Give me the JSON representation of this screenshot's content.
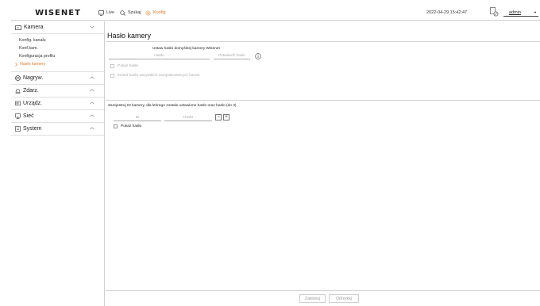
{
  "header": {
    "logo": "WISENET",
    "nav": [
      {
        "label": "Live",
        "icon": "monitor-icon"
      },
      {
        "label": "Szukaj",
        "icon": "search-icon"
      },
      {
        "label": "Konfig",
        "icon": "gear-icon",
        "active": true
      }
    ],
    "datetime": "2022-04-29 15:42:47",
    "user": "admin",
    "accent_color": "#e07b2a"
  },
  "sidebar": {
    "categories": [
      {
        "label": "Kamera",
        "icon": "camera-icon",
        "expanded": true,
        "items": [
          {
            "label": "Konfig. kanału"
          },
          {
            "label": "Konf.kam."
          },
          {
            "label": "Konfiguracja profilu"
          },
          {
            "label": "Hasło kamery",
            "active": true
          }
        ]
      },
      {
        "label": "Nagryw.",
        "icon": "record-icon"
      },
      {
        "label": "Zdarz.",
        "icon": "bell-icon"
      },
      {
        "label": "Urządz.",
        "icon": "device-icon"
      },
      {
        "label": "Sieć",
        "icon": "network-icon"
      },
      {
        "label": "System",
        "icon": "system-icon"
      }
    ]
  },
  "main": {
    "title": "Hasło kamery",
    "section1": {
      "title": "Ustaw hasło domyślnej kamery Wisenet",
      "password_placeholder": "Hasło",
      "confirm_placeholder": "Potwierdź hasło",
      "show_password": "Pokaż hasło",
      "change_all": "Zmień hasło wszystkich zarejestrowanych kamer."
    },
    "section2": {
      "title": "Zarejestruj ID kamery, dla którego zostało ustawione hasło oraz hasło (do 3)",
      "id_placeholder": "ID",
      "password_placeholder": "Hasło",
      "minus": "−",
      "plus": "+",
      "show_password": "Pokaż hasło"
    },
    "footer": {
      "apply": "Zastosuj",
      "cancel": "Odrzykaj"
    }
  }
}
